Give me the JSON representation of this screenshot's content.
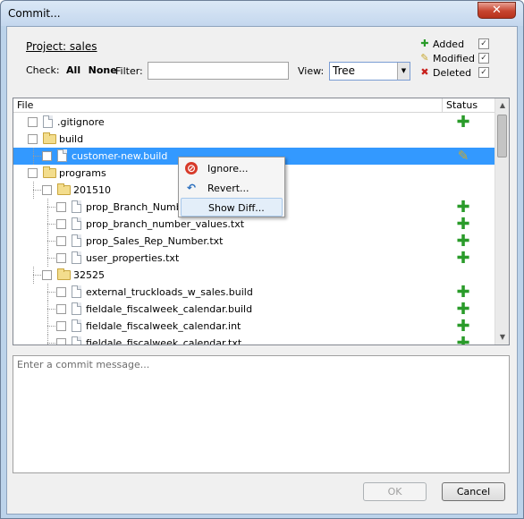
{
  "window": {
    "title": "Commit...",
    "close": "✕"
  },
  "project": {
    "label": "Project: sales"
  },
  "check": {
    "label": "Check:",
    "all": "All",
    "none": "None"
  },
  "filter": {
    "label": "Filter:",
    "value": ""
  },
  "view": {
    "label": "View:",
    "selected": "Tree"
  },
  "legend": [
    {
      "icon": "plus-icon",
      "label": "Added",
      "checked": true
    },
    {
      "icon": "pencil-icon",
      "label": "Modified",
      "checked": true
    },
    {
      "icon": "x-icon",
      "label": "Deleted",
      "checked": true
    }
  ],
  "list": {
    "header_file": "File",
    "header_status": "Status",
    "rows": [
      {
        "name": ".gitignore",
        "type": "file",
        "status": "added"
      },
      {
        "name": "build",
        "type": "folder",
        "status": ""
      },
      {
        "name": "customer-new.build",
        "type": "file",
        "status": "modified",
        "selected": true
      },
      {
        "name": "programs",
        "type": "folder",
        "status": ""
      },
      {
        "name": "201510",
        "type": "folder",
        "status": ""
      },
      {
        "name": "prop_Branch_Number.txt",
        "type": "file",
        "status": "added"
      },
      {
        "name": "prop_branch_number_values.txt",
        "type": "file",
        "status": "added"
      },
      {
        "name": "prop_Sales_Rep_Number.txt",
        "type": "file",
        "status": "added"
      },
      {
        "name": "user_properties.txt",
        "type": "file",
        "status": "added"
      },
      {
        "name": "32525",
        "type": "folder",
        "status": ""
      },
      {
        "name": "external_truckloads_w_sales.build",
        "type": "file",
        "status": "added"
      },
      {
        "name": "fieldale_fiscalweek_calendar.build",
        "type": "file",
        "status": "added"
      },
      {
        "name": "fieldale_fiscalweek_calendar.int",
        "type": "file",
        "status": "added"
      },
      {
        "name": "fieldale_fiscalweek_calendar.txt",
        "type": "file",
        "status": "added"
      }
    ]
  },
  "context_menu": {
    "items": [
      {
        "label": "Ignore...",
        "icon": "ignore-icon"
      },
      {
        "label": "Revert...",
        "icon": "revert-icon"
      },
      {
        "label": "Show Diff...",
        "icon": "",
        "hover": true
      }
    ]
  },
  "commit_message": {
    "placeholder": "Enter a commit message..."
  },
  "buttons": {
    "ok": "OK",
    "cancel": "Cancel"
  },
  "colors": {
    "selection": "#3399ff",
    "added": "#2a9b2a",
    "modified": "#c8a830",
    "deleted": "#c8201c"
  }
}
